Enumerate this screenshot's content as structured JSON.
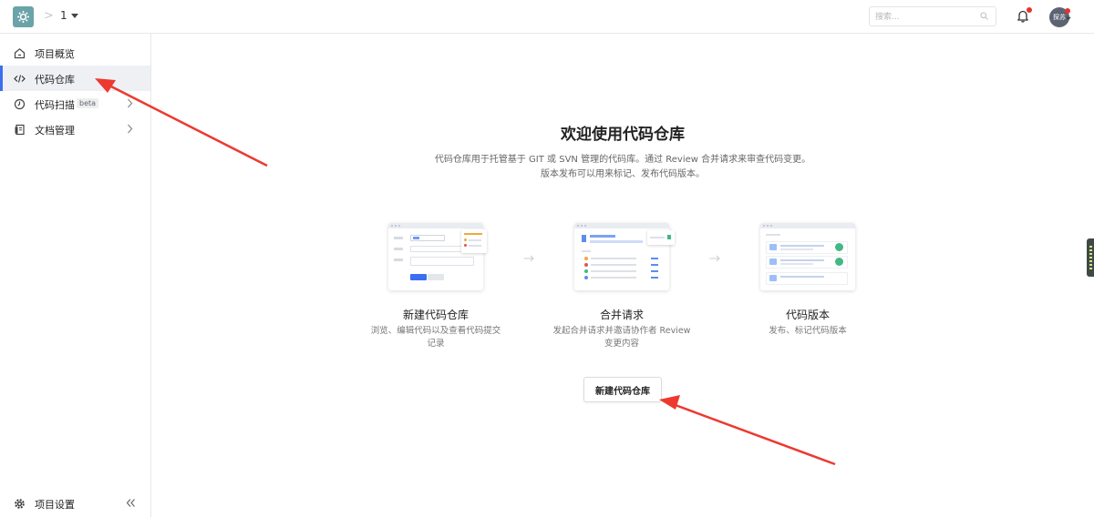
{
  "header": {
    "breadcrumb_separator": ">",
    "project_name": "1",
    "search_placeholder": "搜索...",
    "avatar_text": "探苏"
  },
  "sidebar": {
    "items": [
      {
        "label": "项目概览",
        "icon": "home-icon",
        "active": false
      },
      {
        "label": "代码仓库",
        "icon": "code-icon",
        "active": true
      },
      {
        "label": "代码扫描",
        "icon": "scan-icon",
        "badge": "beta",
        "has_children": true
      },
      {
        "label": "文档管理",
        "icon": "document-icon",
        "has_children": true
      }
    ],
    "footer": {
      "label": "项目设置",
      "icon": "gear-icon",
      "collapse_icon": "double-chevron-left-icon"
    }
  },
  "main": {
    "title": "欢迎使用代码仓库",
    "description_line1": "代码仓库用于托管基于 GIT 或 SVN 管理的代码库。通过 Review 合并请求来审查代码变更。",
    "description_line2": "版本发布可以用来标记、发布代码版本。",
    "steps": [
      {
        "title": "新建代码仓库",
        "desc_line1": "浏览、编辑代码以及查看代码提交",
        "desc_line2": "记录"
      },
      {
        "title": "合并请求",
        "desc_line1": "发起合并请求并邀请协作者 Review",
        "desc_line2": "变更内容"
      },
      {
        "title": "代码版本",
        "desc_line1": "发布、标记代码版本",
        "desc_line2": ""
      }
    ],
    "create_button": "新建代码仓库"
  },
  "colors": {
    "accent": "#3b6ef0",
    "active_bg": "#eef0f4",
    "annotation_arrow": "#ec3a30",
    "notification_dot": "#e5342e"
  }
}
